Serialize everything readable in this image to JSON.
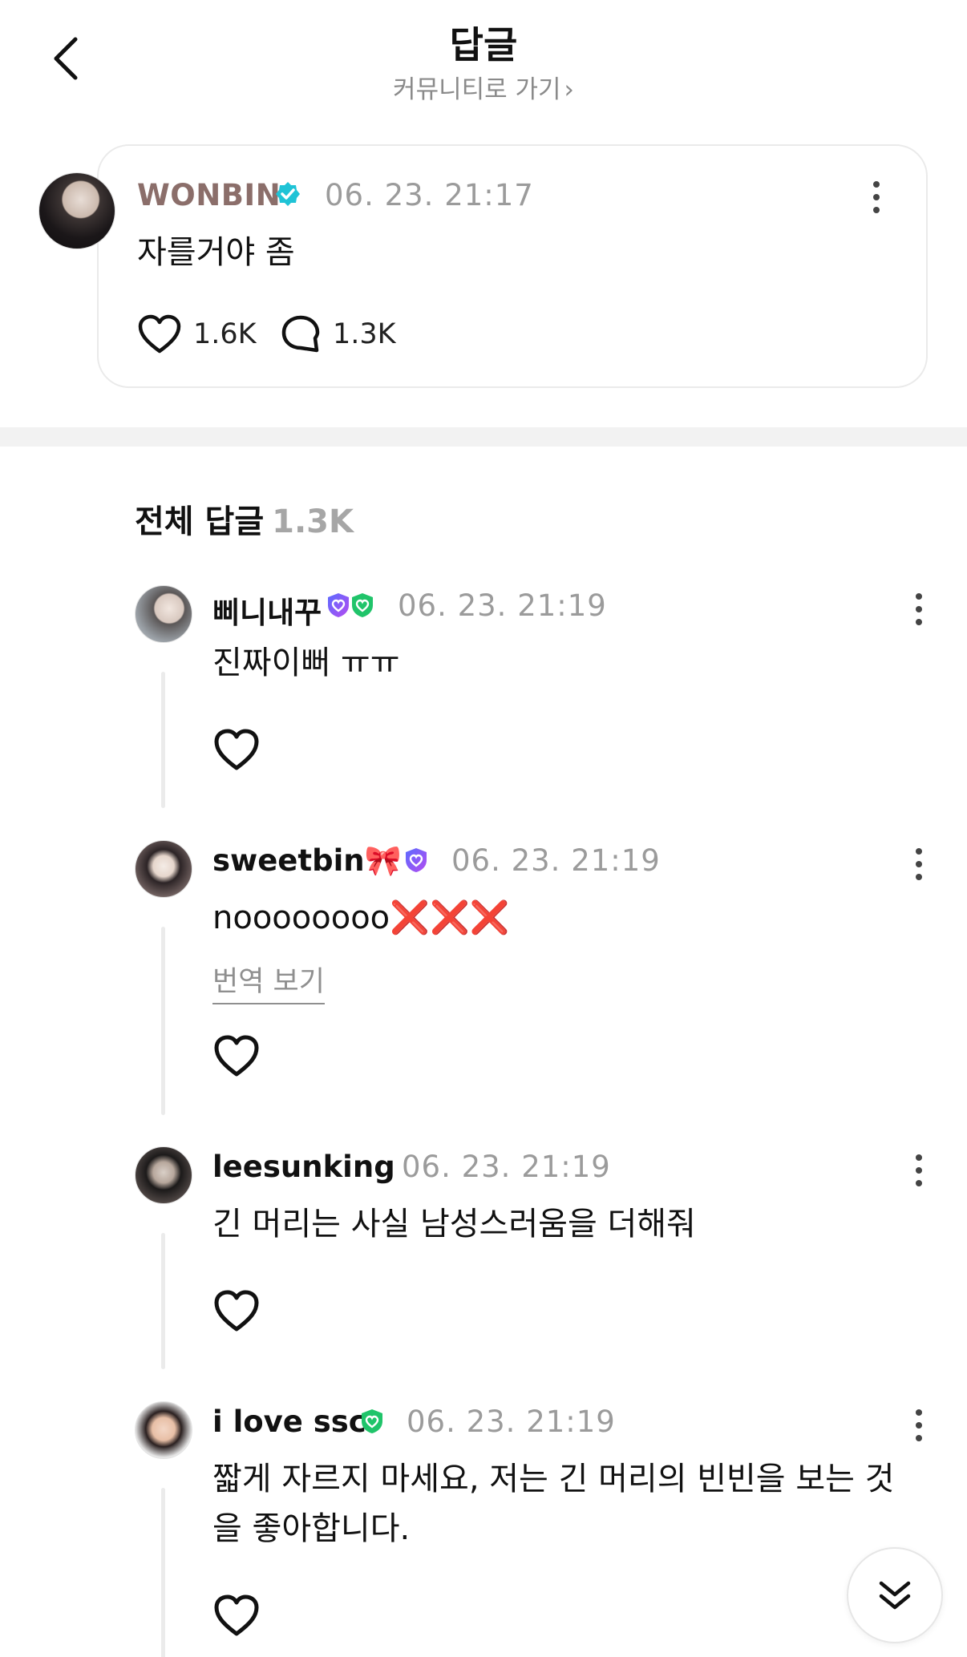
{
  "header": {
    "title": "답글",
    "community_link": "커뮤니티로 가기",
    "community_chevron": "›"
  },
  "post": {
    "author": "WONBIN",
    "time": "06. 23. 21:17",
    "text": "자를거야 좀",
    "likes": "1.6K",
    "comments": "1.3K",
    "icons": {
      "verified": "verified-badge-icon",
      "like": "heart-outline-icon",
      "comment": "speech-bubble-icon",
      "more": "more-vertical-icon"
    },
    "colors": {
      "author": "#8b6e6a",
      "verified": "#1fc3d6"
    }
  },
  "replies_header": {
    "title": "전체 답글",
    "count": "1.3K"
  },
  "replies": [
    {
      "author": "삐니내꾸",
      "time": "06. 23. 21:19",
      "text": "진짜이뻐 ㅠㅠ",
      "badges": [
        "purple-shield-heart-badge",
        "green-shield-heart-badge"
      ]
    },
    {
      "author": "sweetbin🎀",
      "time": "06. 23. 21:19",
      "text": "noooooooo❌❌❌",
      "translate": "번역 보기",
      "badges": [
        "purple-shield-heart-badge"
      ]
    },
    {
      "author": "leesunking",
      "time": "06. 23. 21:19",
      "text": "긴 머리는 사실 남성스러움을 더해줘",
      "badges": []
    },
    {
      "author": "i love ssc",
      "time": "06. 23. 21:19",
      "text": "짧게 자르지 마세요, 저는 긴 머리의 빈빈을 보는 것을 좋아합니다.",
      "badges": [
        "green-shield-heart-badge"
      ]
    }
  ],
  "fab": {
    "icon": "double-chevron-down-icon"
  }
}
